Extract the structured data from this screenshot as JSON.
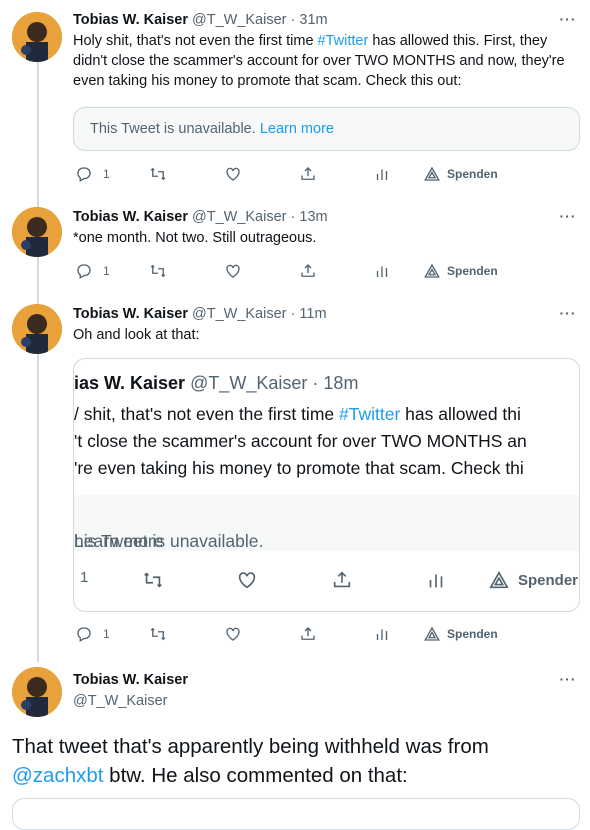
{
  "colors": {
    "accent": "#1d9bf0",
    "muted": "#536471",
    "border": "#cfd9de"
  },
  "tweets": [
    {
      "name": "Tobias W. Kaiser",
      "handle": "@T_W_Kaiser",
      "time": "31m",
      "text_before": "Holy shit, that's not even the first time ",
      "hashtag": "#Twitter",
      "text_after": " has allowed this. First, they didn't close the scammer's account for over TWO MONTHS and now, they're even taking his money to promote that scam. Check this out:",
      "quote_unavailable": "This Tweet is unavailable.",
      "quote_learn_more": "Learn more",
      "replies": "1",
      "spenden": "Spenden"
    },
    {
      "name": "Tobias W. Kaiser",
      "handle": "@T_W_Kaiser",
      "time": "13m",
      "text": "*one month. Not two. Still outrageous.",
      "replies": "1",
      "spenden": "Spenden"
    },
    {
      "name": "Tobias W. Kaiser",
      "handle": "@T_W_Kaiser",
      "time": "11m",
      "text": "Oh and look at that:",
      "quoted": {
        "name": "ias W. Kaiser",
        "handle": "@T_W_Kaiser",
        "time": "18m",
        "line1_before": "/ shit, that's not even the first time ",
        "line1_hashtag": "#Twitter",
        "line1_after": " has allowed thi",
        "line2": "'t close the scammer's account for over TWO MONTHS an",
        "line3": "'re even taking his money to promote that scam. Check thi",
        "unavailable": "his Tweet is unavailable.",
        "learn_more": "Learn more",
        "replies": "1",
        "spenden": "Spender"
      },
      "replies": "1",
      "spenden": "Spenden"
    },
    {
      "name": "Tobias W. Kaiser",
      "handle": "@T_W_Kaiser",
      "text_before": "That tweet that's apparently being withheld was from ",
      "mention": "@zachxbt",
      "text_after": " btw. He also commented on that:"
    }
  ]
}
